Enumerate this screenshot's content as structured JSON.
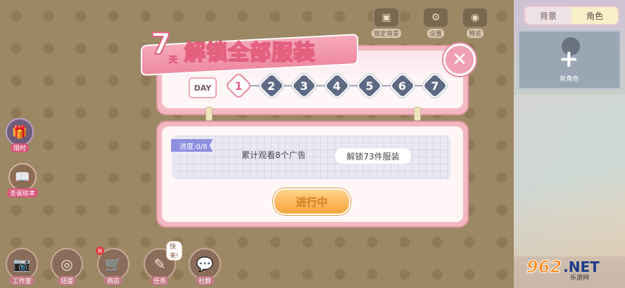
{
  "top_buttons": [
    {
      "icon": "lock-background-icon",
      "label": "锁定背景"
    },
    {
      "icon": "gear-icon",
      "label": "设置"
    },
    {
      "icon": "eye-icon",
      "label": "预览"
    }
  ],
  "right_panel": {
    "tabs": [
      {
        "label": "背景",
        "active": false
      },
      {
        "label": "角色",
        "active": true
      }
    ],
    "slot_label": "新角色"
  },
  "side_buttons": [
    {
      "icon": "gift-icon",
      "label": "限时"
    },
    {
      "icon": "book-icon",
      "label": "圣诞绘本"
    }
  ],
  "bottom_nav": [
    {
      "icon": "camera-icon",
      "label": "工作室"
    },
    {
      "icon": "gacha-icon",
      "label": "扭蛋"
    },
    {
      "icon": "cart-icon",
      "label": "商店",
      "badge": "N"
    },
    {
      "icon": "task-icon",
      "label": "任务",
      "bubble": "快来!"
    },
    {
      "icon": "chat-icon",
      "label": "社群"
    }
  ],
  "dialog": {
    "title_number": "7",
    "title_unit": "天",
    "title_text": "解锁全部服装",
    "day_label": "DAY",
    "steps": [
      "1",
      "2",
      "3",
      "4",
      "5",
      "6",
      "7"
    ],
    "active_step": 1,
    "task": {
      "progress": "进度:0/8",
      "description": "累计观看8个广告",
      "reward": "解锁73件服装"
    },
    "button_label": "进行中"
  },
  "watermark": {
    "number": "962",
    "suffix": ".NET",
    "sub": "乐游网"
  }
}
